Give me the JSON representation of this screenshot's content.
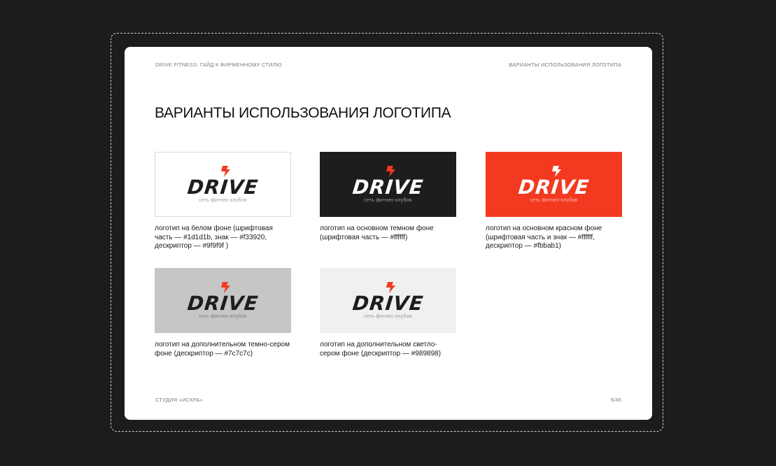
{
  "header": {
    "doc_title": "DRIVE FITNESS: ГАЙД К ФИРМЕННОМУ СТИЛЮ",
    "section": "ВАРИАНТЫ ИСПОЛЬЗОВАНИЯ ЛОГОТИПА"
  },
  "title": "ВАРИАНТЫ ИСПОЛЬЗОВАНИЯ ЛОГОТИПА",
  "logo": {
    "wordmark": "DRIVE",
    "descriptor": "сеть фитнес-клубов"
  },
  "variants": [
    {
      "background": "#ffffff",
      "wordmark_color": "#1d1d1b",
      "mark_color": "#f33920",
      "descriptor_color": "#9f9f9f",
      "caption": "логотип на белом фоне (шрифтовая часть — #1d1d1b, знак — #f33920, дескриптор — #9f9f9f )"
    },
    {
      "background": "#1d1d1b",
      "wordmark_color": "#ffffff",
      "mark_color": "#f33920",
      "descriptor_color": "#9f9f9f",
      "caption": "логотип на основном темном фоне (шрифтовая часть — #ffffff)"
    },
    {
      "background": "#f33920",
      "wordmark_color": "#ffffff",
      "mark_color": "#ffffff",
      "descriptor_color": "#fbbab1",
      "caption": "логотип на основном красном фоне (шрифтовая часть и знак — #ffffff, дескриптор — #fbbab1)"
    },
    {
      "background": "#c6c6c6",
      "wordmark_color": "#1d1d1b",
      "mark_color": "#f33920",
      "descriptor_color": "#7c7c7c",
      "caption": "логотип на дополнительном темно-сером фоне (дескриптор — #7c7c7c)"
    },
    {
      "background": "#f0f0f0",
      "wordmark_color": "#1d1d1b",
      "mark_color": "#f33920",
      "descriptor_color": "#989898",
      "caption": "логотип на дополнительном светло-сером фоне (дескриптор — #989898)"
    }
  ],
  "footer": {
    "studio": "СТУДИЯ «ИСКРА»",
    "page": "5/45"
  }
}
